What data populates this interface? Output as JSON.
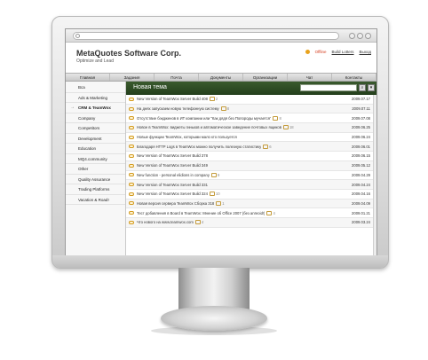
{
  "header": {
    "brand": "MetaQuotes Software Corp.",
    "tagline": "Optimize and Lead",
    "offline_label": "Offline",
    "user_link": "Build Lotters",
    "exit_link": "Выход"
  },
  "nav": [
    "Главная",
    "Задания",
    "Почта",
    "Документы",
    "Организации",
    "Чат",
    "Контакты"
  ],
  "sidebar": [
    {
      "label": "Bca",
      "active": false
    },
    {
      "label": "Ads & Marketing",
      "active": false
    },
    {
      "label": "CRM & TeamWox",
      "active": true
    },
    {
      "label": "Company",
      "active": false
    },
    {
      "label": "Competitors",
      "active": false
    },
    {
      "label": "Development",
      "active": false
    },
    {
      "label": "Education",
      "active": false
    },
    {
      "label": "MQ4.community",
      "active": false
    },
    {
      "label": "Other",
      "active": false
    },
    {
      "label": "Quality Assurance",
      "active": false
    },
    {
      "label": "Trading Platforms",
      "active": false
    },
    {
      "label": "Vacation & Road!",
      "active": false
    }
  ],
  "panel": {
    "title": "Новая тема",
    "search_placeholder": "",
    "search_icon": "search-icon",
    "filter_icon": "filter-icon",
    "accent_color": "#2f4d25"
  },
  "topics": [
    {
      "title": "New Version of TeamWox Server Build 408",
      "count": "2",
      "date": "2009.07.17"
    },
    {
      "title": "На днях запускаем новую телефонную систему",
      "count": "8",
      "date": "2009.07.11"
    },
    {
      "title": "Отсутствие бэкдженов в ИТ компании или \"Как дядя без Попороды мучается\"",
      "count": "8",
      "date": "2009.07.08"
    },
    {
      "title": "Новое в TeamWox: виджеты гиньков и автоматическое заведение почтовых ящиков",
      "count": "18",
      "date": "2009.06.25"
    },
    {
      "title": "Новые функции TeamWox, которыми мало кто пользуется",
      "count": "",
      "date": "2009.06.24"
    },
    {
      "title": "Благодаря HTTP Logs в TeamWox можно получить полезную статистику",
      "count": "6",
      "date": "2009.06.01"
    },
    {
      "title": "New Version of TeamWox Server Build 378",
      "count": "",
      "date": "2009.06.15"
    },
    {
      "title": "New Version of TeamWox Server Build 349",
      "count": "",
      "date": "2009.05.12"
    },
    {
      "title": "New function - personal elidions in company",
      "count": "9",
      "date": "2009.04.29"
    },
    {
      "title": "New Version of TeamWox Server Build 331",
      "count": "",
      "date": "2009.04.24"
    },
    {
      "title": "New Version of TeamWox Server Build 324",
      "count": "10",
      "date": "2009.04.16"
    },
    {
      "title": "Новая версия сервера TeamWox Сборка 318",
      "count": "1",
      "date": "2009.04.09"
    },
    {
      "title": "Тест добавления в Board в TeamWox: Мнение об Office 2007 (без anreoid!)",
      "count": "4",
      "date": "2009.01.21"
    },
    {
      "title": "Что нового на www.teamwox.com",
      "count": "4",
      "date": "2009.03.24"
    }
  ]
}
